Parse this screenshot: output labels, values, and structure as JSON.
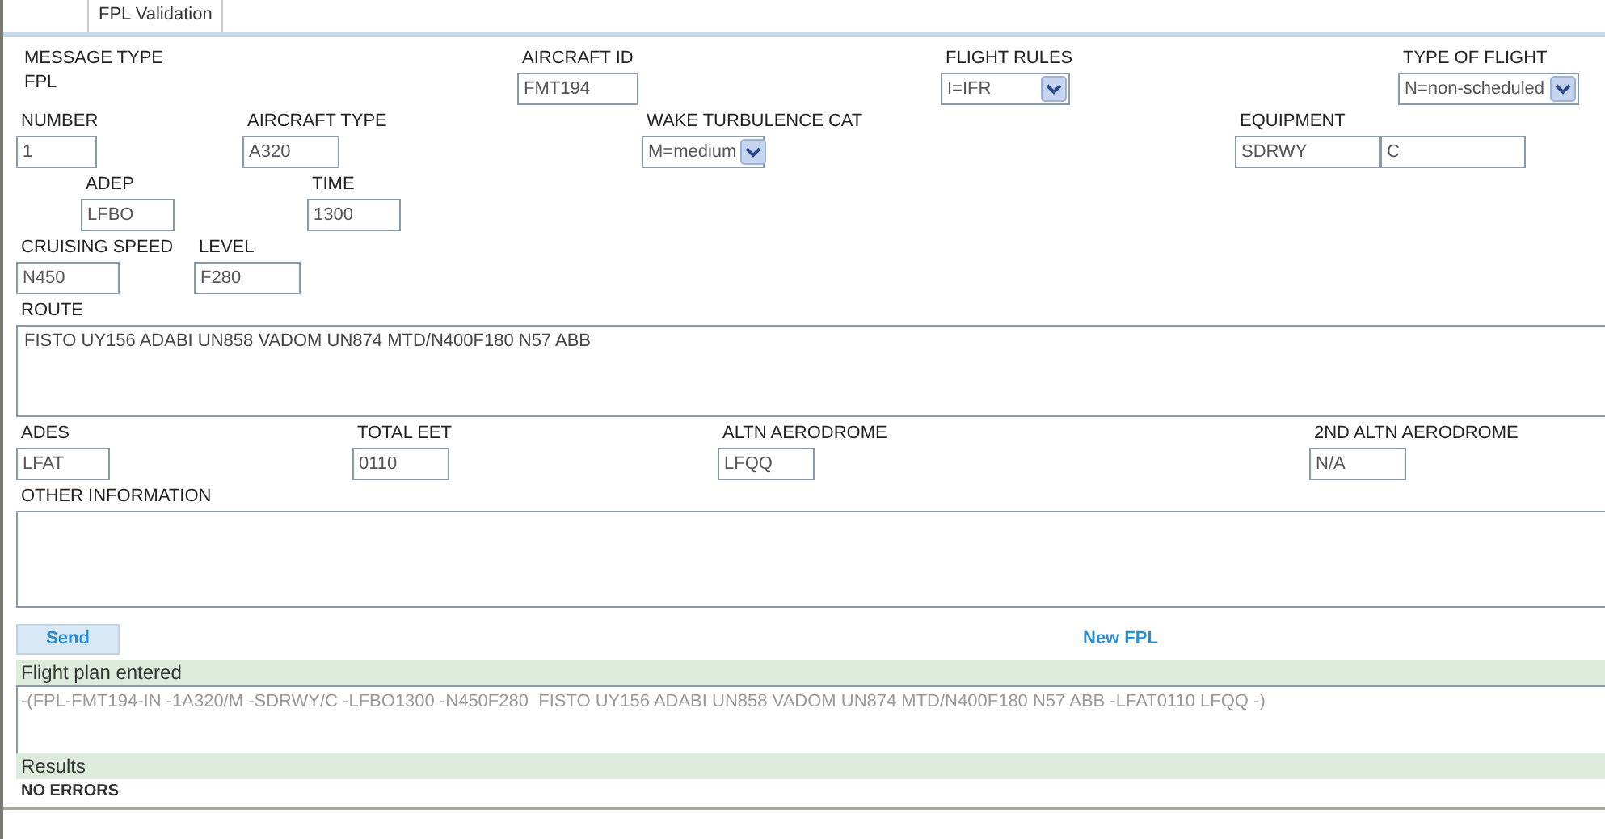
{
  "tab": {
    "label": "FPL Validation"
  },
  "rows": [
    [
      {
        "kind": "static",
        "label": "MESSAGE TYPE",
        "value": "FPL"
      },
      {
        "kind": "text",
        "label": "AIRCRAFT ID",
        "value": "FMT194"
      },
      {
        "kind": "select",
        "label": "FLIGHT RULES",
        "value": "I=IFR"
      },
      {
        "kind": "select",
        "label": "TYPE OF FLIGHT",
        "value": "N=non-scheduled"
      }
    ],
    [
      {
        "kind": "text",
        "label": "NUMBER",
        "value": "1"
      },
      {
        "kind": "text",
        "label": "AIRCRAFT TYPE",
        "value": "A320"
      },
      {
        "kind": "select",
        "label": "WAKE TURBULENCE CAT",
        "value": "M=medium"
      },
      {
        "kind": "double",
        "label": "EQUIPMENT",
        "values": [
          "SDRWY",
          "C"
        ]
      }
    ],
    [
      {
        "kind": "text",
        "label": "ADEP",
        "value": "LFBO"
      },
      {
        "kind": "text",
        "label": "TIME",
        "value": "1300"
      }
    ],
    [
      {
        "kind": "text",
        "label": "CRUISING SPEED",
        "value": "N450"
      },
      {
        "kind": "text",
        "label": "LEVEL",
        "value": "F280"
      }
    ],
    [
      {
        "kind": "area",
        "label": "ROUTE",
        "value": "FISTO UY156 ADABI UN858 VADOM UN874 MTD/N400F180 N57 ABB"
      }
    ],
    [
      {
        "kind": "text",
        "label": "ADES",
        "value": "LFAT"
      },
      {
        "kind": "text",
        "label": "TOTAL EET",
        "value": "0110"
      },
      {
        "kind": "text",
        "label": "ALTN AERODROME",
        "value": "LFQQ"
      },
      {
        "kind": "text",
        "label": "2ND ALTN AERODROME",
        "value": "N/A"
      }
    ],
    [
      {
        "kind": "area",
        "label": "OTHER INFORMATION"
      }
    ]
  ],
  "send_button": "Send",
  "new_fpl_link": "New FPL",
  "flight_plan": {
    "heading": "Flight plan entered",
    "text": "-(FPL-FMT194-IN -1A320/M -SDRWY/C -LFBO1300 -N450F280  FISTO UY156 ADABI UN858 VADOM UN874 MTD/N400F180 N57 ABB -LFAT0110 LFQQ -)"
  },
  "results": {
    "heading": "Results",
    "text": "NO ERRORS"
  }
}
